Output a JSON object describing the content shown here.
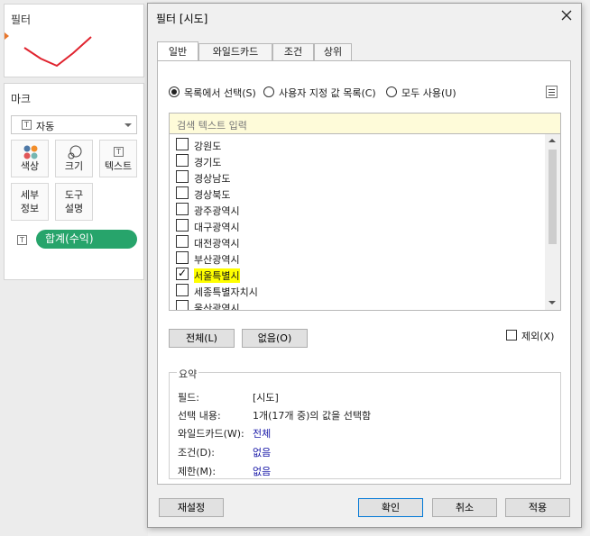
{
  "left_panel": {
    "filters_title": "필터",
    "marks_title": "마크",
    "mark_type": "자동",
    "mark_buttons": {
      "color": "색상",
      "size": "크기",
      "text": "텍스트",
      "detail": "세부\n정보",
      "tooltip": "도구\n설명"
    },
    "pill_label": "합계(수익)"
  },
  "dialog": {
    "title": "필터 [시도]",
    "tabs": [
      "일반",
      "와일드카드",
      "조건",
      "상위"
    ],
    "radios": [
      {
        "label": "목록에서 선택(S)",
        "selected": true
      },
      {
        "label": "사용자 지정 값 목록(C)",
        "selected": false
      },
      {
        "label": "모두 사용(U)",
        "selected": false
      }
    ],
    "search_placeholder": "검색 텍스트 입력",
    "items": [
      {
        "label": "강원도",
        "checked": false
      },
      {
        "label": "경기도",
        "checked": false
      },
      {
        "label": "경상남도",
        "checked": false
      },
      {
        "label": "경상북도",
        "checked": false
      },
      {
        "label": "광주광역시",
        "checked": false
      },
      {
        "label": "대구광역시",
        "checked": false
      },
      {
        "label": "대전광역시",
        "checked": false
      },
      {
        "label": "부산광역시",
        "checked": false
      },
      {
        "label": "서울특별시",
        "checked": true
      },
      {
        "label": "세종특별자치시",
        "checked": false
      },
      {
        "label": "울산광역시",
        "checked": false
      }
    ],
    "all_button": "전체(L)",
    "none_button": "없음(O)",
    "exclude_label": "제외(X)",
    "summary": {
      "title": "요약",
      "field_key": "필드:",
      "field_val": "[시도]",
      "selection_key": "선택 내용:",
      "selection_val": "1개(17개 중)의 값을 선택함",
      "wildcard_key": "와일드카드(W):",
      "wildcard_val": "전체",
      "condition_key": "조건(D):",
      "condition_val": "없음",
      "limit_key": "제한(M):",
      "limit_val": "없음"
    },
    "reset_button": "재설정",
    "ok_button": "확인",
    "cancel_button": "취소",
    "apply_button": "적용"
  },
  "colors": {
    "pill": "#27a46b",
    "highlight": "#ffff00",
    "link": "#1a1aa8",
    "accent_border": "#0078d7"
  }
}
